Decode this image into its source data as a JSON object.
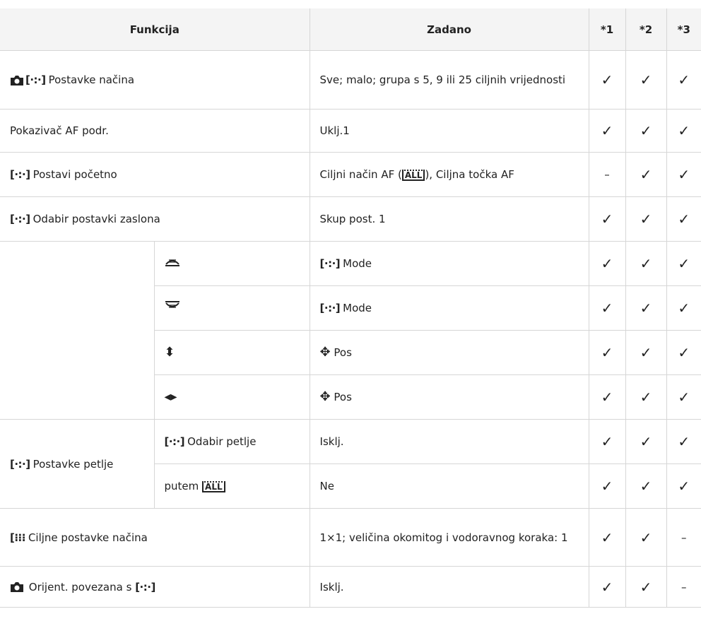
{
  "header": {
    "col_func": "Funkcija",
    "col_default": "Zadano",
    "col1": "*1",
    "col2": "*2",
    "col3": "*3"
  },
  "bracket": "[·:·]",
  "icons": {
    "camera": "camera-icon",
    "check": "check-icon",
    "dash": "dash-icon",
    "dial_front": "front-dial-icon",
    "dial_rear": "rear-dial-icon",
    "updown": "up-down-arrows-icon",
    "leftright": "left-right-arrows-icon",
    "cross": "cross-pad-icon",
    "all_target": "all-target-icon",
    "pattern": "target-pattern-icon"
  },
  "rows": [
    {
      "name": "Postavke načina",
      "default": "Sve; malo; grupa s 5, 9 ili 25 ciljnih vrijednosti",
      "c1": "✓",
      "c2": "✓",
      "c3": "✓"
    },
    {
      "name": "Pokazivač AF podr.",
      "default": "Uklj.1",
      "c1": "✓",
      "c2": "✓",
      "c3": "✓"
    },
    {
      "name": "Postavi početno",
      "default_a": "Ciljni način AF (",
      "default_all": "ALL",
      "default_b": "), Ciljna točka AF",
      "c1": "–",
      "c2": "✓",
      "c3": "✓"
    },
    {
      "name": "Odabir postavki zaslona",
      "default": "Skup post. 1",
      "c1": "✓",
      "c2": "✓",
      "c3": "✓"
    },
    {
      "default": "Mode",
      "c1": "✓",
      "c2": "✓",
      "c3": "✓"
    },
    {
      "default": "Mode",
      "c1": "✓",
      "c2": "✓",
      "c3": "✓"
    },
    {
      "default": "Pos",
      "c1": "✓",
      "c2": "✓",
      "c3": "✓"
    },
    {
      "default": "Pos",
      "c1": "✓",
      "c2": "✓",
      "c3": "✓"
    },
    {
      "group": "Postavke petlje",
      "sub": "Odabir petlje",
      "default": "Isklj.",
      "c1": "✓",
      "c2": "✓",
      "c3": "✓"
    },
    {
      "sub": "putem",
      "sub_all": "ALL",
      "default": "Ne",
      "c1": "✓",
      "c2": "✓",
      "c3": "✓"
    },
    {
      "name": "Ciljne postavke načina",
      "default": "1×1; veličina okomitog i vodoravnog koraka: 1",
      "c1": "✓",
      "c2": "✓",
      "c3": "–"
    },
    {
      "name": "Orijent. povezana s",
      "default": "Isklj.",
      "c1": "✓",
      "c2": "✓",
      "c3": "–"
    }
  ]
}
